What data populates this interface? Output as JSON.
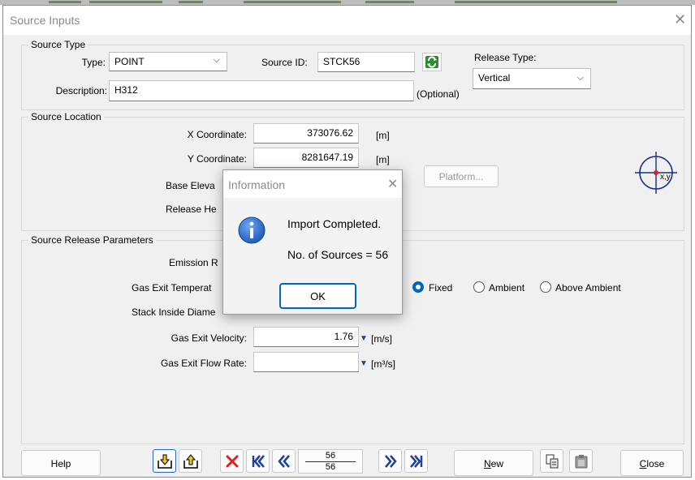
{
  "window": {
    "title": "Source Inputs"
  },
  "source_type": {
    "legend": "Source Type",
    "type_label": "Type:",
    "type_value": "POINT",
    "source_id_label": "Source ID:",
    "source_id_value": "STCK56",
    "release_type_label": "Release Type:",
    "release_type_value": "Vertical",
    "description_label": "Description:",
    "description_value": "H312",
    "optional_text": "(Optional)"
  },
  "source_location": {
    "legend": "Source Location",
    "x_label": "X Coordinate:",
    "x_value": "373076.62",
    "x_unit": "[m]",
    "y_label": "Y Coordinate:",
    "y_value": "8281647.19",
    "y_unit": "[m]",
    "base_elev_label_visible": "Base Eleva",
    "release_height_label_visible": "Release He",
    "platform_button": "Platform...",
    "xy_icon_text": "x,y"
  },
  "release_params": {
    "legend": "Source Release Parameters",
    "emission_label_visible": "Emission R",
    "gas_temp_label_visible": "Gas Exit Temperat",
    "stack_diam_label_visible": "Stack Inside Diame",
    "velocity_label": "Gas Exit Velocity:",
    "velocity_value": "1.76",
    "velocity_unit": "[m/s]",
    "flow_label": "Gas Exit Flow Rate:",
    "flow_value": "",
    "flow_unit": "[m³/s]",
    "radio_fixed": "Fixed",
    "radio_ambient": "Ambient",
    "radio_above": "Above Ambient"
  },
  "toolbar": {
    "help": "Help",
    "page_current": "56",
    "page_total": "56",
    "new_prefix": "N",
    "new_rest": "ew",
    "close_prefix": "C",
    "close_rest": "lose"
  },
  "dialog": {
    "title": "Information",
    "line1": "Import Completed.",
    "line2": "No. of Sources = 56",
    "ok": "OK"
  },
  "colors": {
    "accent": "#0067c0",
    "delete_red": "#e02020",
    "nav_blue": "#1f3fa0",
    "refresh_green": "#2e8b2e"
  }
}
